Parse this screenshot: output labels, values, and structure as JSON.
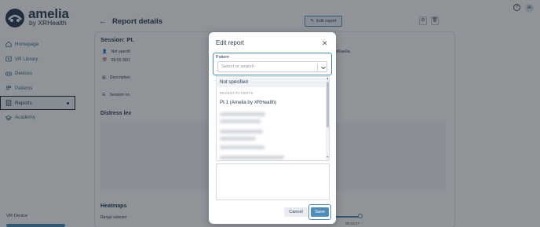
{
  "app": {
    "brand": "amelia",
    "brand_sub": "by XRHealth",
    "accent_color": "#4f8db8"
  },
  "sidebar": {
    "items": [
      {
        "label": "Homepage",
        "icon": "home-icon"
      },
      {
        "label": "VR Library",
        "icon": "library-icon"
      },
      {
        "label": "Devices",
        "icon": "vr-headset-icon"
      },
      {
        "label": "Patients",
        "icon": "users-icon"
      },
      {
        "label": "Reports",
        "icon": "reports-icon",
        "active": true
      },
      {
        "label": "Academy",
        "icon": "academy-icon"
      }
    ],
    "vr_device_label": "VR Device"
  },
  "header": {
    "title": "Report details",
    "edit_button": "Edit report",
    "avatar": "AI"
  },
  "report": {
    "session_title": "Session: Pt.",
    "not_specified": "Not specifi",
    "time": "09:55 30/1",
    "description": "Description",
    "session_notes": "Session no",
    "hash": "74913f487db8d8e8e2a319e948d5ae0a",
    "distress_title": "Distress lev",
    "heatmaps_title": "Heatmaps",
    "range_label": "Range selector",
    "range_end": "00:53:47"
  },
  "modal": {
    "title": "Edit report",
    "patient_label": "Patient",
    "select_placeholder": "Select or search",
    "options": {
      "not_specified": "Not specified",
      "recent_heading": "RECENT PATIENTS",
      "recent_patient": "Pt.1 (Amelia by XRHealth)"
    },
    "cancel_label": "Cancel",
    "save_label": "Save"
  }
}
